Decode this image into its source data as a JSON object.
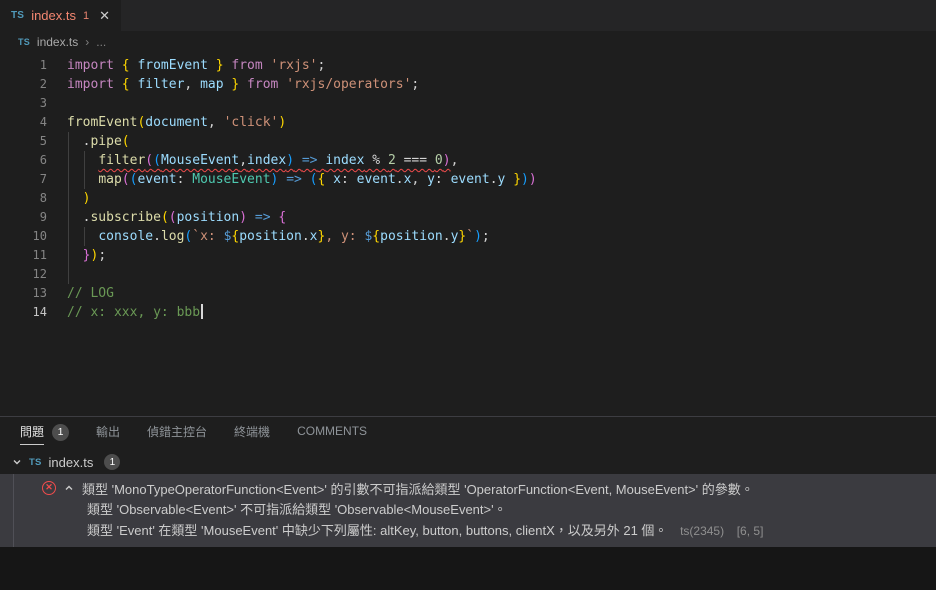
{
  "tab": {
    "icon": "TS",
    "file": "index.ts",
    "badge": "1",
    "close": "✕"
  },
  "breadcrumb": {
    "icon": "TS",
    "file": "index.ts",
    "separator": "›",
    "more": "..."
  },
  "editor": {
    "lines": [
      {
        "n": "1",
        "seg": [
          [
            "import ",
            "kw"
          ],
          [
            "{ ",
            "b1"
          ],
          [
            "fromEvent",
            "v"
          ],
          [
            " } ",
            "b1"
          ],
          [
            "from ",
            "kw"
          ],
          [
            "'rxjs'",
            "s"
          ],
          [
            ";",
            "p"
          ]
        ]
      },
      {
        "n": "2",
        "seg": [
          [
            "import ",
            "kw"
          ],
          [
            "{ ",
            "b1"
          ],
          [
            "filter",
            "v"
          ],
          [
            ", ",
            "p"
          ],
          [
            "map",
            "v"
          ],
          [
            " } ",
            "b1"
          ],
          [
            "from ",
            "kw"
          ],
          [
            "'rxjs/operators'",
            "s"
          ],
          [
            ";",
            "p"
          ]
        ]
      },
      {
        "n": "3",
        "seg": []
      },
      {
        "n": "4",
        "seg": [
          [
            "fromEvent",
            "fn"
          ],
          [
            "(",
            "b1"
          ],
          [
            "document",
            "v"
          ],
          [
            ", ",
            "p"
          ],
          [
            "'click'",
            "s"
          ],
          [
            ")",
            "b1"
          ]
        ]
      },
      {
        "n": "5",
        "seg": [
          [
            "  .",
            "p"
          ],
          [
            "pipe",
            "fn"
          ],
          [
            "(",
            "b1"
          ]
        ]
      },
      {
        "n": "6",
        "seg": [
          [
            "    ",
            "p"
          ],
          [
            "filter",
            "fn sq"
          ],
          [
            "(",
            "b2 sq"
          ],
          [
            "(",
            "b3 sq"
          ],
          [
            "MouseEvent",
            "v sq"
          ],
          [
            ",",
            "p sq"
          ],
          [
            "index",
            "v sq"
          ],
          [
            ")",
            "b3 sq"
          ],
          [
            " ",
            "p sq"
          ],
          [
            "=>",
            "ar sq"
          ],
          [
            " ",
            "p sq"
          ],
          [
            "index",
            "v sq"
          ],
          [
            " % ",
            "p sq"
          ],
          [
            "2",
            "n sq"
          ],
          [
            " === ",
            "p sq"
          ],
          [
            "0",
            "n sq"
          ],
          [
            ")",
            "b2 sq"
          ],
          [
            ",",
            "p"
          ]
        ]
      },
      {
        "n": "7",
        "seg": [
          [
            "    ",
            "p"
          ],
          [
            "map",
            "fn"
          ],
          [
            "(",
            "b2"
          ],
          [
            "(",
            "b3"
          ],
          [
            "event",
            "v"
          ],
          [
            ": ",
            "p"
          ],
          [
            "MouseEvent",
            "t"
          ],
          [
            ")",
            "b3"
          ],
          [
            " ",
            "p"
          ],
          [
            "=>",
            "ar"
          ],
          [
            " ",
            "p"
          ],
          [
            "(",
            "b3"
          ],
          [
            "{",
            "b1"
          ],
          [
            " ",
            "p"
          ],
          [
            "x",
            "v"
          ],
          [
            ": ",
            "p"
          ],
          [
            "event",
            "v"
          ],
          [
            ".",
            "p"
          ],
          [
            "x",
            "v"
          ],
          [
            ", ",
            "p"
          ],
          [
            "y",
            "v"
          ],
          [
            ": ",
            "p"
          ],
          [
            "event",
            "v"
          ],
          [
            ".",
            "p"
          ],
          [
            "y",
            "v"
          ],
          [
            " ",
            "p"
          ],
          [
            "}",
            "b1"
          ],
          [
            ")",
            "b3"
          ],
          [
            ")",
            "b2"
          ]
        ]
      },
      {
        "n": "8",
        "seg": [
          [
            "  ",
            "p"
          ],
          [
            ")",
            "b1"
          ]
        ]
      },
      {
        "n": "9",
        "seg": [
          [
            "  .",
            "p"
          ],
          [
            "subscribe",
            "fn"
          ],
          [
            "(",
            "b1"
          ],
          [
            "(",
            "b2"
          ],
          [
            "position",
            "v"
          ],
          [
            ")",
            "b2"
          ],
          [
            " ",
            "p"
          ],
          [
            "=>",
            "ar"
          ],
          [
            " ",
            "p"
          ],
          [
            "{",
            "b2"
          ]
        ]
      },
      {
        "n": "10",
        "seg": [
          [
            "    ",
            "p"
          ],
          [
            "console",
            "v"
          ],
          [
            ".",
            "p"
          ],
          [
            "log",
            "fn"
          ],
          [
            "(",
            "b3"
          ],
          [
            "`x: ",
            "s"
          ],
          [
            "$",
            "ar"
          ],
          [
            "{",
            "b1"
          ],
          [
            "position",
            "v"
          ],
          [
            ".",
            "p"
          ],
          [
            "x",
            "v"
          ],
          [
            "}",
            "b1"
          ],
          [
            ", y: ",
            "s"
          ],
          [
            "$",
            "ar"
          ],
          [
            "{",
            "b1"
          ],
          [
            "position",
            "v"
          ],
          [
            ".",
            "p"
          ],
          [
            "y",
            "v"
          ],
          [
            "}",
            "b1"
          ],
          [
            "`",
            "s"
          ],
          [
            ")",
            "b3"
          ],
          [
            ";",
            "p"
          ]
        ]
      },
      {
        "n": "11",
        "seg": [
          [
            "  ",
            "p"
          ],
          [
            "}",
            "b2"
          ],
          [
            ")",
            "b1"
          ],
          [
            ";",
            "p"
          ]
        ]
      },
      {
        "n": "12",
        "seg": []
      },
      {
        "n": "13",
        "seg": [
          [
            "// LOG",
            "c"
          ]
        ]
      },
      {
        "n": "14",
        "seg": [
          [
            "// x: xxx, y: bbb",
            "c"
          ]
        ],
        "cursor": true,
        "active": true
      }
    ]
  },
  "panel": {
    "tabs": [
      {
        "label": "問題",
        "badge": "1",
        "active": true
      },
      {
        "label": "輸出"
      },
      {
        "label": "偵錯主控台"
      },
      {
        "label": "終端機"
      },
      {
        "label": "COMMENTS"
      }
    ],
    "tree": {
      "icon": "TS",
      "file": "index.ts",
      "badge": "1"
    },
    "problems": {
      "icon_glyph": "✕",
      "line1": "類型 'MonoTypeOperatorFunction<Event>' 的引數不可指派給類型 'OperatorFunction<Event, MouseEvent>' 的參數。",
      "line2": "類型 'Observable<Event>' 不可指派給類型 'Observable<MouseEvent>'。",
      "line3": "類型 'Event' 在類型 'MouseEvent' 中缺少下列屬性: altKey, button, buttons, clientX，以及另外 21 個。",
      "code": "ts(2345)",
      "position": "[6, 5]"
    }
  }
}
